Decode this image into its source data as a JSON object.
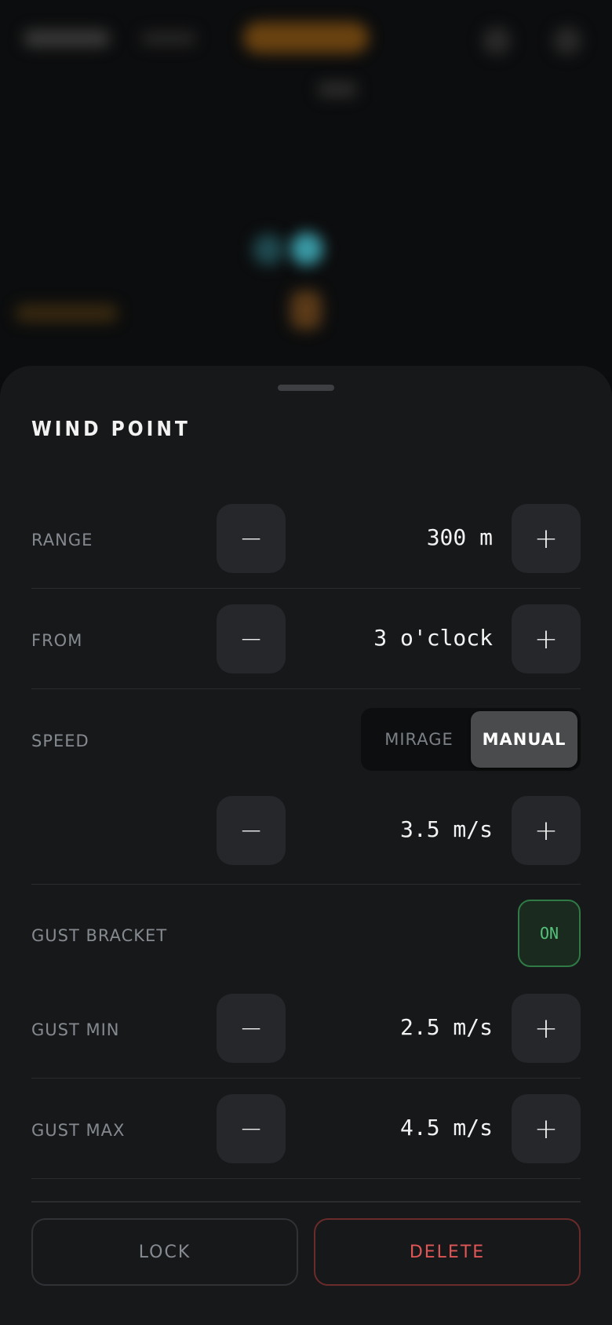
{
  "sheet": {
    "title": "WIND POINT"
  },
  "rows": {
    "range": {
      "label": "RANGE",
      "value": "300 m",
      "minus": "−",
      "plus": "+"
    },
    "from": {
      "label": "FROM",
      "value": "3 o'clock",
      "minus": "−",
      "plus": "+"
    },
    "speed": {
      "label": "SPEED",
      "mode_options": [
        "MIRAGE",
        "MANUAL"
      ],
      "selected_mode": "MANUAL",
      "value": "3.5 m/s",
      "minus": "−",
      "plus": "+"
    },
    "gust_bracket": {
      "label": "GUST BRACKET",
      "toggle": "ON"
    },
    "gust_min": {
      "label": "GUST MIN",
      "value": "2.5 m/s",
      "minus": "−",
      "plus": "+"
    },
    "gust_max": {
      "label": "GUST MAX",
      "value": "4.5 m/s",
      "minus": "−",
      "plus": "+"
    }
  },
  "footer": {
    "lock_label": "LOCK",
    "delete_label": "DELETE"
  },
  "colors": {
    "sheet_bg": "#17181a",
    "toggle_on": "#55c27a",
    "delete_accent": "#e05555",
    "backdrop_accent_orange": "#b7771a",
    "backdrop_accent_teal": "#3fb6c4"
  }
}
